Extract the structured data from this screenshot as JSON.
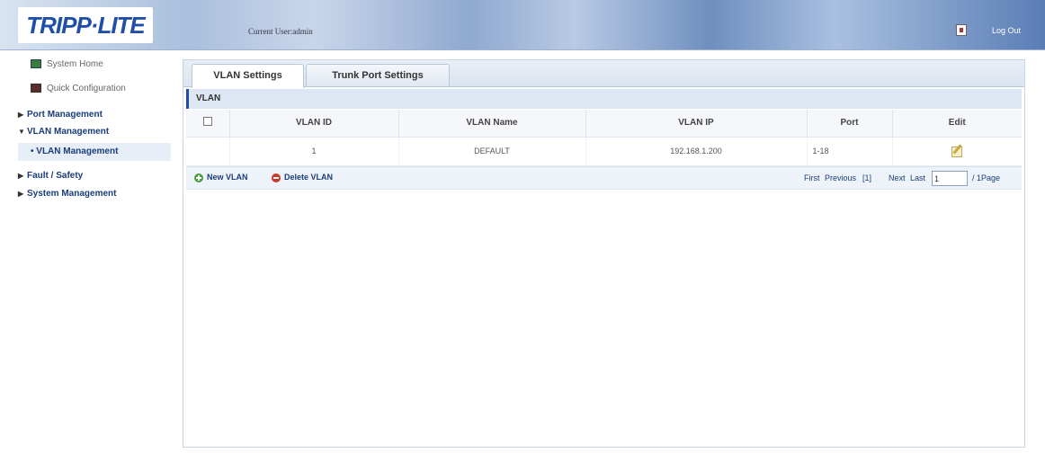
{
  "header": {
    "logo": "TRIPP·LITE",
    "current_user": "Current User:admin",
    "logout_label": "Log Out"
  },
  "sidebar": {
    "items": [
      {
        "label": "System Home",
        "icon": "home-icon"
      },
      {
        "label": "Quick Configuration",
        "icon": "quick-config-icon"
      },
      {
        "label": "Port Management",
        "expanded": false
      },
      {
        "label": "VLAN Management",
        "expanded": true
      },
      {
        "label": "VLAN Management",
        "selected": true
      },
      {
        "label": "Fault / Safety",
        "expanded": false
      },
      {
        "label": "System Management",
        "expanded": false
      }
    ]
  },
  "tabs": [
    {
      "label": "VLAN Settings",
      "active": true
    },
    {
      "label": "Trunk Port Settings",
      "active": false
    }
  ],
  "section_title": "VLAN",
  "table": {
    "columns": [
      "VLAN ID",
      "VLAN Name",
      "VLAN IP",
      "Port",
      "Edit"
    ],
    "rows": [
      {
        "vlan_id": "1",
        "vlan_name": "DEFAULT",
        "vlan_ip": "192.168.1.200",
        "port": "1-18"
      }
    ]
  },
  "actions": {
    "new_vlan": "New VLAN",
    "delete_vlan": "Delete VLAN"
  },
  "pager": {
    "first": "First",
    "previous": "Previous",
    "current_page": "[1]",
    "next": "Next",
    "last": "Last",
    "page_input": "1",
    "total": "/ 1Page"
  },
  "colors": {
    "brand_blue": "#1f4fa8",
    "link_blue": "#1a3d7a",
    "current_page_red": "#c0392b"
  }
}
